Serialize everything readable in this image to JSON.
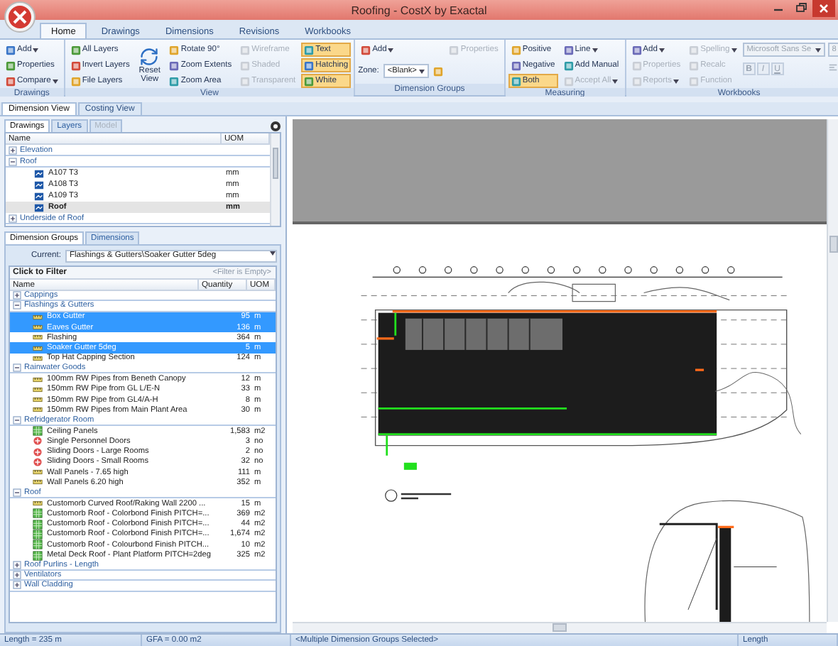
{
  "window": {
    "title": "Roofing - CostX by Exactal"
  },
  "ribbon_tabs": [
    {
      "label": "Home",
      "selected": true
    },
    {
      "label": "Drawings",
      "selected": false
    },
    {
      "label": "Dimensions",
      "selected": false
    },
    {
      "label": "Revisions",
      "selected": false
    },
    {
      "label": "Workbooks",
      "selected": false
    }
  ],
  "ribbon_groups": [
    {
      "title": "Drawings",
      "columns": [
        [
          {
            "kind": "menu",
            "label": "Add",
            "disabled": false
          },
          {
            "kind": "button",
            "label": "Properties",
            "disabled": false
          },
          {
            "kind": "menu",
            "label": "Compare",
            "disabled": false
          }
        ]
      ]
    },
    {
      "title": "View",
      "columns": [
        [
          {
            "kind": "button",
            "label": "All Layers",
            "disabled": false
          },
          {
            "kind": "button",
            "label": "Invert Layers",
            "disabled": false
          },
          {
            "kind": "button",
            "label": "File Layers",
            "disabled": false
          }
        ],
        [
          {
            "kind": "large",
            "label": "Reset View",
            "disabled": false
          }
        ],
        [
          {
            "kind": "button",
            "label": "Rotate 90°",
            "disabled": false
          },
          {
            "kind": "button",
            "label": "Zoom Extents",
            "disabled": false
          },
          {
            "kind": "button",
            "label": "Zoom Area",
            "disabled": false
          }
        ],
        [
          {
            "kind": "button",
            "label": "Wireframe",
            "disabled": true
          },
          {
            "kind": "button",
            "label": "Shaded",
            "disabled": true
          },
          {
            "kind": "button",
            "label": "Transparent",
            "disabled": true
          }
        ],
        [
          {
            "kind": "toggle",
            "label": "Text",
            "disabled": false,
            "selected": true
          },
          {
            "kind": "toggle",
            "label": "Hatching",
            "disabled": false,
            "selected": true
          },
          {
            "kind": "toggle",
            "label": "White",
            "disabled": false,
            "selected": true
          }
        ]
      ]
    },
    {
      "title": "Dimension Groups",
      "columns": [
        [
          {
            "kind": "menu",
            "label": "Add",
            "disabled": false
          },
          {
            "kind": "field",
            "label": "Zone:",
            "value": "<Blank>",
            "disabled": false
          }
        ],
        [
          {
            "kind": "button",
            "label": "Properties",
            "disabled": true
          }
        ]
      ]
    },
    {
      "title": "Measuring",
      "columns": [
        [
          {
            "kind": "toggle",
            "label": "Positive",
            "disabled": false,
            "selected": false
          },
          {
            "kind": "toggle",
            "label": "Negative",
            "disabled": false,
            "selected": false
          },
          {
            "kind": "toggle",
            "label": "Both",
            "disabled": false,
            "selected": true
          }
        ],
        [
          {
            "kind": "menu",
            "label": "Line",
            "disabled": false
          },
          {
            "kind": "button",
            "label": "Add Manual",
            "disabled": false
          },
          {
            "kind": "menu",
            "label": "Accept All",
            "disabled": true
          }
        ]
      ]
    },
    {
      "title": "Workbooks",
      "columns": [
        [
          {
            "kind": "menu",
            "label": "Add",
            "disabled": false
          },
          {
            "kind": "button",
            "label": "Properties",
            "disabled": true
          },
          {
            "kind": "menu",
            "label": "Reports",
            "disabled": true
          }
        ],
        [
          {
            "kind": "menu",
            "label": "Spelling",
            "disabled": true
          },
          {
            "kind": "button",
            "label": "Recalc",
            "disabled": true
          },
          {
            "kind": "button",
            "label": "Function",
            "disabled": true
          }
        ],
        [
          {
            "kind": "select",
            "value": "Microsoft Sans Se",
            "disabled": true
          },
          {
            "kind": "format",
            "buttons": [
              "B",
              "I",
              "U"
            ],
            "disabled": true
          }
        ],
        [
          {
            "kind": "select",
            "value": "8",
            "disabled": true
          },
          {
            "kind": "align",
            "disabled": true
          }
        ]
      ]
    }
  ],
  "view_tabs": [
    {
      "label": "Dimension View",
      "selected": true
    },
    {
      "label": "Costing View",
      "selected": false
    }
  ],
  "drawings_panel": {
    "tabs": [
      {
        "label": "Drawings",
        "selected": true,
        "disabled": false
      },
      {
        "label": "Layers",
        "selected": false,
        "disabled": false
      },
      {
        "label": "Model",
        "selected": false,
        "disabled": true
      }
    ],
    "columns": [
      "Name",
      "UOM"
    ],
    "tree": [
      {
        "label": "Elevation",
        "expanded": false
      },
      {
        "label": "Roof",
        "expanded": true,
        "children": [
          {
            "label": "A107 T3",
            "uom": "mm",
            "selected": false
          },
          {
            "label": "A108 T3",
            "uom": "mm",
            "selected": false
          },
          {
            "label": "A109 T3",
            "uom": "mm",
            "selected": false
          },
          {
            "label": "Roof",
            "uom": "mm",
            "selected": true
          }
        ]
      },
      {
        "label": "Underside of Roof",
        "expanded": false
      }
    ]
  },
  "dimensions_panel": {
    "tabs": [
      {
        "label": "Dimension Groups",
        "selected": true
      },
      {
        "label": "Dimensions",
        "selected": false
      }
    ],
    "current_label": "Current:",
    "current_value": "Flashings & Gutters\\Soaker Gutter 5deg",
    "filter_label": "Click to Filter",
    "filter_hint": "<Filter is Empty>",
    "columns": [
      "Name",
      "Quantity",
      "UOM"
    ],
    "groups": [
      {
        "label": "Cappings",
        "expanded": false
      },
      {
        "label": "Flashings & Gutters",
        "expanded": true,
        "children": [
          {
            "kind": "length",
            "label": "Box Gutter",
            "quantity": "95",
            "uom": "m",
            "selected": true
          },
          {
            "kind": "length",
            "label": "Eaves Gutter",
            "quantity": "136",
            "uom": "m",
            "selected": true
          },
          {
            "kind": "length",
            "label": "Flashing",
            "quantity": "364",
            "uom": "m",
            "selected": false
          },
          {
            "kind": "length",
            "label": "Soaker Gutter 5deg",
            "quantity": "5",
            "uom": "m",
            "selected": true
          },
          {
            "kind": "length",
            "label": "Top Hat Capping Section",
            "quantity": "124",
            "uom": "m",
            "selected": false
          }
        ]
      },
      {
        "label": "Rainwater Goods",
        "expanded": true,
        "children": [
          {
            "kind": "length",
            "label": "100mm RW Pipes from Beneth Canopy",
            "quantity": "12",
            "uom": "m",
            "selected": false
          },
          {
            "kind": "length",
            "label": "150mm RW Pipe from GL L/E-N",
            "quantity": "33",
            "uom": "m",
            "selected": false
          },
          {
            "kind": "length",
            "label": "150mm RW Pipe from GL4/A-H",
            "quantity": "8",
            "uom": "m",
            "selected": false
          },
          {
            "kind": "length",
            "label": "150mm RW Pipes from Main Plant Area",
            "quantity": "30",
            "uom": "m",
            "selected": false
          }
        ]
      },
      {
        "label": "Refridgerator Room",
        "expanded": true,
        "children": [
          {
            "kind": "area",
            "label": "Ceiling Panels",
            "quantity": "1,583",
            "uom": "m2",
            "selected": false
          },
          {
            "kind": "count",
            "label": "Single Personnel Doors",
            "quantity": "3",
            "uom": "no",
            "selected": false
          },
          {
            "kind": "count",
            "label": "Sliding Doors - Large Rooms",
            "quantity": "2",
            "uom": "no",
            "selected": false
          },
          {
            "kind": "count",
            "label": "Sliding Doors - Small Rooms",
            "quantity": "32",
            "uom": "no",
            "selected": false
          },
          {
            "kind": "length",
            "label": "Wall Panels - 7.65 high",
            "quantity": "111",
            "uom": "m",
            "selected": false
          },
          {
            "kind": "length",
            "label": "Wall Panels 6.20 high",
            "quantity": "352",
            "uom": "m",
            "selected": false
          }
        ]
      },
      {
        "label": "Roof",
        "expanded": true,
        "children": [
          {
            "kind": "length",
            "label": "Customorb Curved Roof/Raking Wall 2200 ...",
            "quantity": "15",
            "uom": "m",
            "selected": false
          },
          {
            "kind": "area",
            "label": "Customorb Roof - Colorbond Finish PITCH=...",
            "quantity": "369",
            "uom": "m2",
            "selected": false
          },
          {
            "kind": "area",
            "label": "Customorb Roof - Colorbond Finish PITCH=...",
            "quantity": "44",
            "uom": "m2",
            "selected": false
          },
          {
            "kind": "area",
            "label": "Customorb Roof - Colorbond Finish PITCH=...",
            "quantity": "1,674",
            "uom": "m2",
            "selected": false
          },
          {
            "kind": "area",
            "label": "Customorb Roof - Colourbond Finish PITCH...",
            "quantity": "10",
            "uom": "m2",
            "selected": false
          },
          {
            "kind": "area",
            "label": "Metal Deck Roof - Plant Platform PITCH=2deg",
            "quantity": "325",
            "uom": "m2",
            "selected": false
          }
        ]
      },
      {
        "label": "Roof Purlins - Length",
        "expanded": false
      },
      {
        "label": "Ventilators",
        "expanded": false
      },
      {
        "label": "Wall Cladding",
        "expanded": false
      }
    ]
  },
  "status_bar": [
    "Length = 235 m",
    "GFA = 0.00 m2",
    "<Multiple Dimension Groups Selected>",
    "Length"
  ]
}
